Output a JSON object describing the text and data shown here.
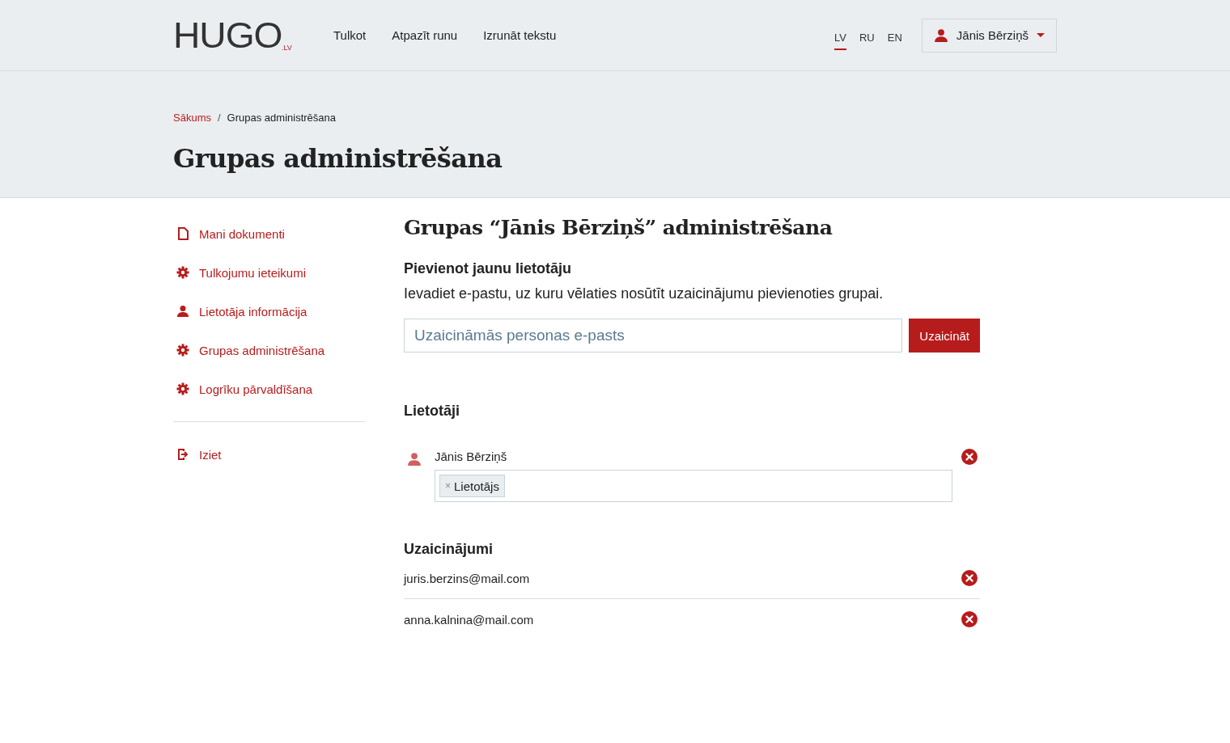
{
  "logo": {
    "text": "HUGO",
    "suffix": ".LV"
  },
  "nav": [
    "Tulkot",
    "Atpazīt runu",
    "Izrunāt tekstu"
  ],
  "languages": [
    {
      "label": "LV",
      "selected": true
    },
    {
      "label": "RU",
      "selected": false
    },
    {
      "label": "EN",
      "selected": false
    }
  ],
  "user_menu": {
    "name": "Jānis Bērziņš"
  },
  "breadcrumb": {
    "separator": "/",
    "items": [
      {
        "label": "Sākums",
        "link": true
      },
      {
        "label": "Grupas administrēšana",
        "link": false
      }
    ]
  },
  "page_title": "Grupas administrēšana",
  "sidebar": {
    "items": [
      {
        "label": "Mani dokumenti",
        "kind": "document"
      },
      {
        "label": "Tulkojumu ieteikumi",
        "kind": "gear"
      },
      {
        "label": "Lietotāja informācija",
        "kind": "user"
      },
      {
        "label": "Grupas administrēšana",
        "kind": "gear"
      },
      {
        "label": "Logrīku pārvaldīšana",
        "kind": "gear"
      }
    ],
    "logout": {
      "label": "Iziet"
    }
  },
  "main": {
    "title": "Grupas “Jānis Bērziņš” administrēšana",
    "add_user": {
      "heading": "Pievienot jaunu lietotāju",
      "description": "Ievadiet e-pastu, uz kuru vēlaties nosūtīt uzaicinājumu pievienoties grupai.",
      "placeholder": "Uzaicināmās personas e-pasts",
      "button": "Uzaicināt"
    },
    "users": {
      "heading": "Lietotāji",
      "items": [
        {
          "name": "Jānis Bērziņš",
          "roles": [
            {
              "remove": "×",
              "label": "Lietotājs"
            }
          ]
        }
      ]
    },
    "invitations": {
      "heading": "Uzaicinājumi",
      "items": [
        "juris.berzins@mail.com",
        "anna.kalnina@mail.com"
      ]
    }
  }
}
